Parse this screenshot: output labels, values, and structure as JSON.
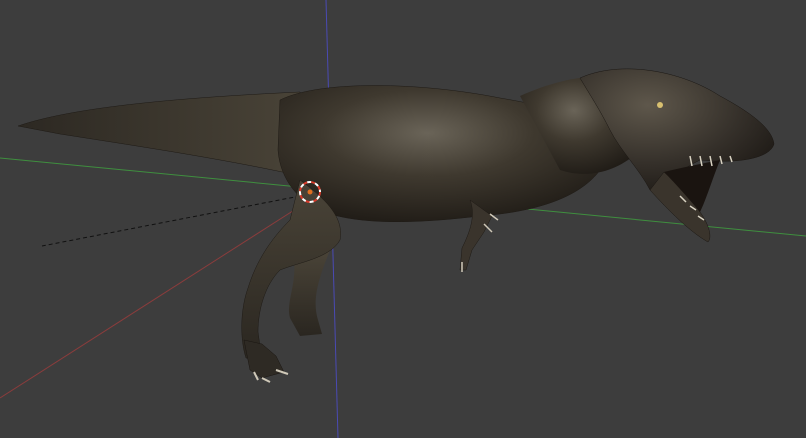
{
  "viewport": {
    "name": "3D Viewport",
    "background_color": "#3d3d3d"
  },
  "axes": {
    "x_axis_color": "#8a3c3c",
    "y_axis_color": "#3f8f3f",
    "z_axis_color": "#4a4ab4"
  },
  "scene_object": {
    "type": "tyrannosaurus-model",
    "base_color": "#3a342c",
    "shadow_color": "#1e1a15",
    "highlight_color": "#6a6458"
  },
  "cursor_3d": {
    "ring_colors": [
      "#d83a2a",
      "#ffffff"
    ],
    "center_color": "#e07020"
  }
}
